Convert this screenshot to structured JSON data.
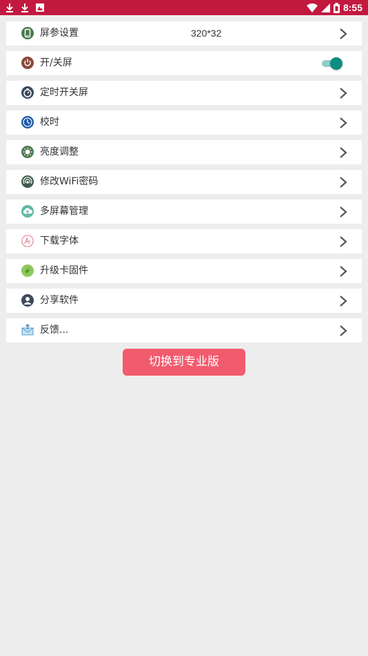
{
  "status_bar": {
    "time": "8:55",
    "left_icons": [
      "download-icon",
      "download-icon",
      "gallery-icon"
    ],
    "right_icons": [
      "wifi-icon",
      "signal-icon",
      "battery-icon"
    ],
    "color": "#c2193f"
  },
  "settings": {
    "items": [
      {
        "label": "屏参设置",
        "value": "320*32",
        "icon": "phone-icon"
      },
      {
        "label": "开/关屏",
        "icon": "power-icon",
        "toggle_on": true
      },
      {
        "label": "定时开关屏",
        "icon": "timer-icon"
      },
      {
        "label": "校时",
        "icon": "clock-icon"
      },
      {
        "label": "亮度调整",
        "icon": "brightness-icon"
      },
      {
        "label": "修改WiFi密码",
        "icon": "wifi-signal-icon"
      },
      {
        "label": "多屏幕管理",
        "icon": "cloud-upload-icon"
      },
      {
        "label": "下载字体",
        "icon": "font-icon"
      },
      {
        "label": "升级卡固件",
        "icon": "tag-icon"
      },
      {
        "label": "分享软件",
        "icon": "person-icon"
      },
      {
        "label": "反馈...",
        "icon": "mail-icon"
      }
    ]
  },
  "pro_button": {
    "label": "切换到专业版",
    "color": "#f25b6e"
  },
  "toggle_color": "#0f8c7f"
}
